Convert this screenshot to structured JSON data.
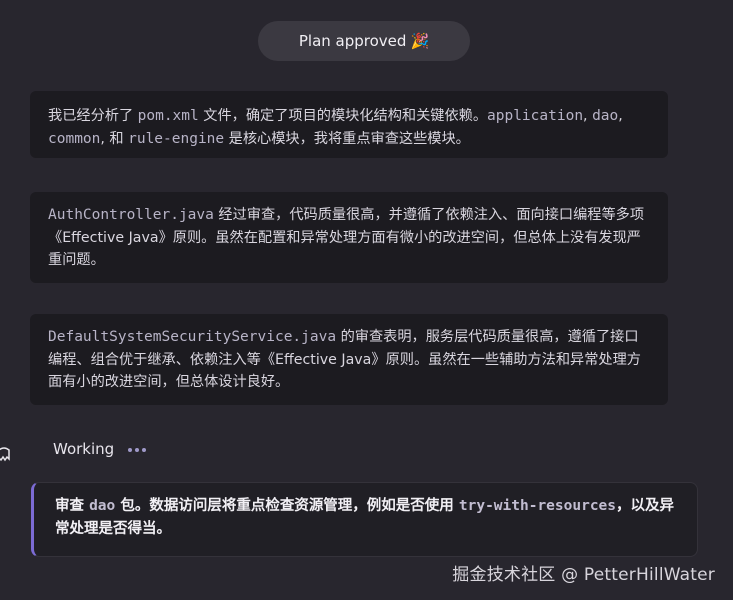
{
  "status_pill": {
    "label": "Plan approved",
    "emoji": "🎉"
  },
  "messages": [
    {
      "parts": [
        "我已经分析了 ",
        "pom.xml",
        " 文件，确定了项目的模块化结构和关键依赖。",
        "application",
        ", ",
        "dao",
        ", ",
        "common",
        ", 和 ",
        "rule-engine",
        " 是核心模块，我将重点审查这些模块。"
      ]
    },
    {
      "parts": [
        "AuthController.java",
        " 经过审查，代码质量很高，并遵循了依赖注入、面向接口编程等多项《Effective Java》原则。虽然在配置和异常处理方面有微小的改进空间，但总体上没有发现严重问题。"
      ]
    },
    {
      "parts": [
        "DefaultSystemSecurityService.java",
        " 的审查表明，服务层代码质量很高，遵循了接口编程、组合优于继承、依赖注入等《Effective Java》原则。虽然在一些辅助方法和异常处理方面有小的改进空间，但总体设计良好。"
      ]
    }
  ],
  "working": {
    "label": "Working"
  },
  "callout": {
    "parts": [
      "审查 ",
      "dao",
      " 包。数据访问层将重点检查资源管理，例如是否使用 ",
      "try-with-resources",
      "，以及异常处理是否得当。"
    ]
  },
  "watermark": "掘金技术社区 @ PetterHillWater",
  "colors": {
    "background": "#28262e",
    "card": "#1c1b20",
    "accent": "#7c6bd4"
  }
}
